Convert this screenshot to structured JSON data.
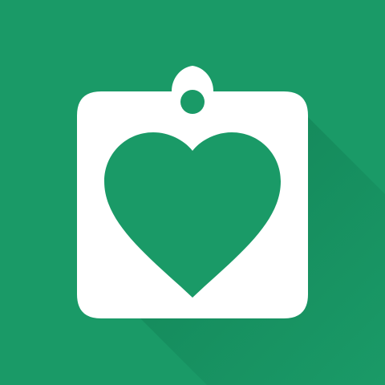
{
  "app_icon": {
    "icon_name": "clipboard-heart-icon",
    "colors": {
      "background": "#1a9a67",
      "shadow": "#0f7d53",
      "badge": "#ffffff",
      "heart": "#1a9a67"
    }
  }
}
